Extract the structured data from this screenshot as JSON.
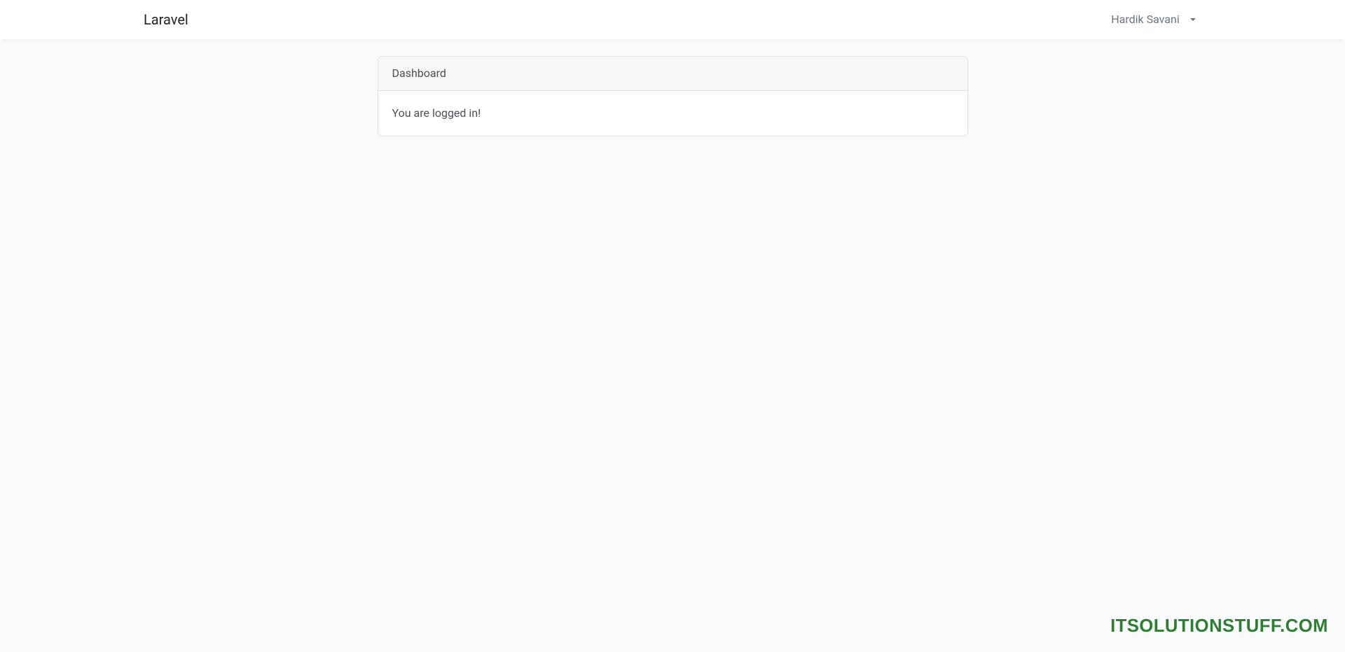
{
  "navbar": {
    "brand": "Laravel",
    "user_name": "Hardik Savani"
  },
  "card": {
    "header": "Dashboard",
    "body": "You are logged in!"
  },
  "watermark": "ITSOLUTIONSTUFF.COM"
}
